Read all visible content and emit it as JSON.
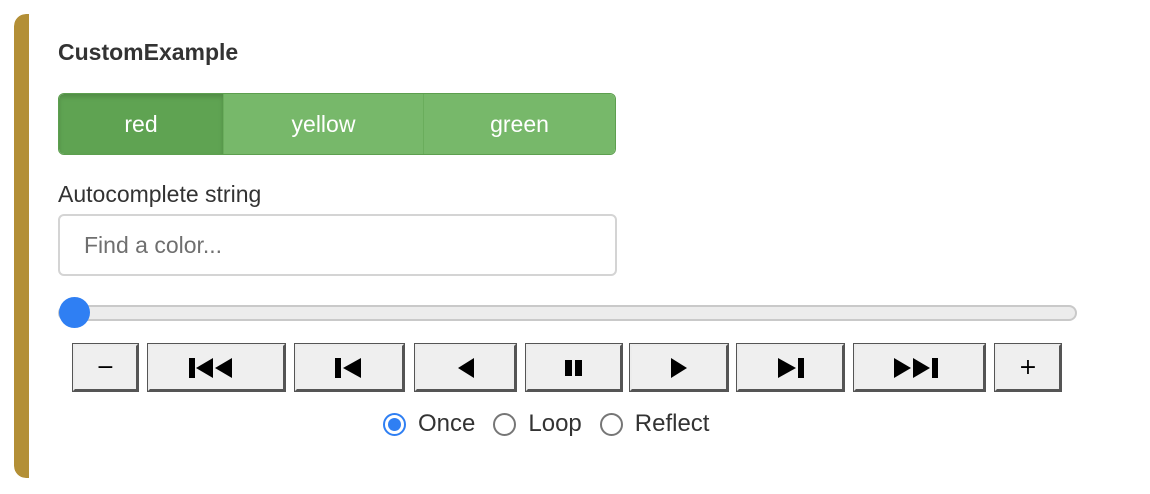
{
  "widget": {
    "title": "CustomExample"
  },
  "color_buttons": {
    "items": [
      {
        "label": "red",
        "active": true
      },
      {
        "label": "yellow",
        "active": false
      },
      {
        "label": "green",
        "active": false
      }
    ]
  },
  "autocomplete": {
    "label": "Autocomplete string",
    "value": "",
    "placeholder": "Find a color..."
  },
  "slider": {
    "value_fraction": 0.0
  },
  "player": {
    "buttons": [
      {
        "name": "decrease-speed-button",
        "icon": "minus-icon",
        "label": "−"
      },
      {
        "name": "first-frame-button",
        "icon": "skip-to-start-icon"
      },
      {
        "name": "previous-frame-button",
        "icon": "step-back-icon"
      },
      {
        "name": "play-reverse-button",
        "icon": "play-reverse-icon"
      },
      {
        "name": "pause-button",
        "icon": "pause-icon"
      },
      {
        "name": "play-button",
        "icon": "play-icon"
      },
      {
        "name": "next-frame-button",
        "icon": "step-forward-icon"
      },
      {
        "name": "last-frame-button",
        "icon": "skip-to-end-icon"
      },
      {
        "name": "increase-speed-button",
        "icon": "plus-icon",
        "label": "+"
      }
    ],
    "loop_modes": [
      {
        "label": "Once",
        "checked": true
      },
      {
        "label": "Loop",
        "checked": false
      },
      {
        "label": "Reflect",
        "checked": false
      }
    ]
  },
  "colors": {
    "accent_bar": "#b38f36",
    "button_active": "#5fa352",
    "button_normal": "#77b86a",
    "slider_thumb": "#2f7ff3",
    "radio_checked": "#2f7ff3"
  }
}
